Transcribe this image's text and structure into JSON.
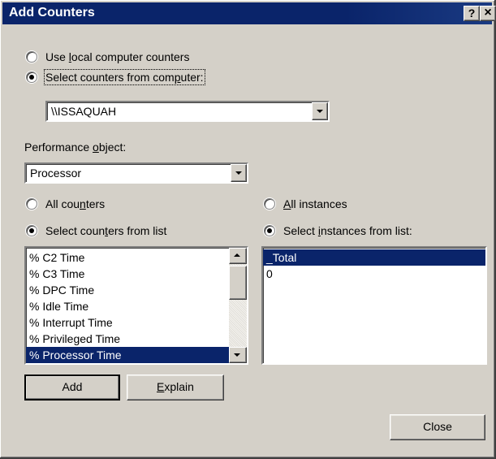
{
  "window": {
    "title": "Add Counters",
    "help_button": "?",
    "close_button": "×"
  },
  "source": {
    "local_option": {
      "pre": "Use ",
      "accel": "l",
      "post": "ocal computer counters",
      "checked": false
    },
    "remote_option": {
      "pre": "Select counters from com",
      "accel": "p",
      "post": "uter:",
      "checked": true
    },
    "computer_value": "\\\\ISSAQUAH"
  },
  "object": {
    "label_pre": "Performance ",
    "label_accel": "o",
    "label_post": "bject:",
    "value": "Processor"
  },
  "counters": {
    "all_option": {
      "pre": "All cou",
      "accel": "n",
      "post": "ters",
      "checked": false
    },
    "list_option": {
      "pre": "Select coun",
      "accel": "t",
      "post": "ers from list",
      "checked": true
    },
    "items": [
      {
        "label": "% C2 Time",
        "selected": false
      },
      {
        "label": "% C3 Time",
        "selected": false
      },
      {
        "label": "% DPC Time",
        "selected": false
      },
      {
        "label": "% Idle Time",
        "selected": false
      },
      {
        "label": "% Interrupt Time",
        "selected": false
      },
      {
        "label": "% Privileged Time",
        "selected": false
      },
      {
        "label": "% Processor Time",
        "selected": true
      }
    ]
  },
  "instances": {
    "all_option": {
      "pre": "",
      "accel": "A",
      "post": "ll instances",
      "checked": false
    },
    "list_option": {
      "pre": "Select ",
      "accel": "i",
      "post": "nstances from list:",
      "checked": true
    },
    "items": [
      {
        "label": "_Total",
        "selected": true
      },
      {
        "label": "0",
        "selected": false
      }
    ]
  },
  "buttons": {
    "add": "Add",
    "explain_accel": "E",
    "explain_rest": "xplain",
    "close": "Close"
  },
  "colors": {
    "titlebar": "#0a246a",
    "face": "#d4d0c8",
    "selection": "#0a246a"
  }
}
